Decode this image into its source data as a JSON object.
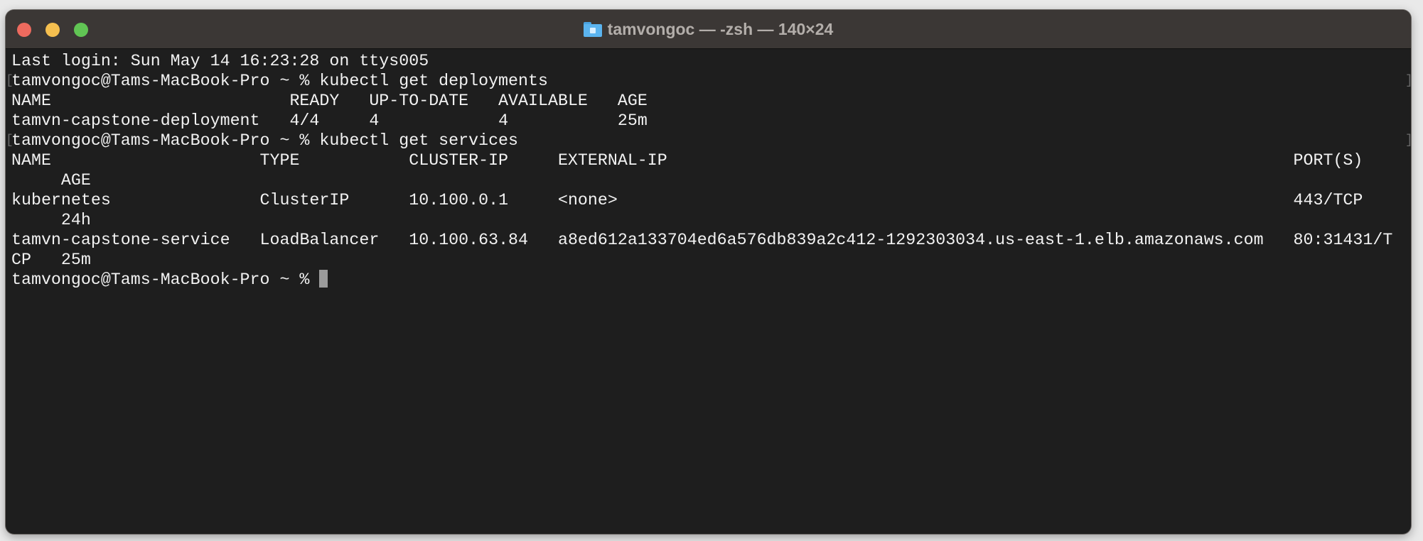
{
  "window": {
    "title": "tamvongoc — -zsh — 140×24",
    "title_icon": "home-folder-icon",
    "traffic_lights": {
      "close": "#ed6a5e",
      "minimize": "#f5bf4f",
      "zoom": "#61c554"
    }
  },
  "terminal": {
    "background": "#1e1e1e",
    "foreground": "#f2f2f2",
    "last_login": "Last login: Sun May 14 16:23:28 on ttys005",
    "prompt": "tamvongoc@Tams-MacBook-Pro ~ % ",
    "commands": [
      {
        "command": "kubectl get deployments",
        "output": {
          "headers": [
            "NAME",
            "READY",
            "UP-TO-DATE",
            "AVAILABLE",
            "AGE"
          ],
          "rows": [
            [
              "tamvn-capstone-deployment",
              "4/4",
              "4",
              "4",
              "25m"
            ]
          ]
        }
      },
      {
        "command": "kubectl get services",
        "output": {
          "headers": [
            "NAME",
            "TYPE",
            "CLUSTER-IP",
            "EXTERNAL-IP",
            "PORT(S)",
            "AGE"
          ],
          "rows": [
            [
              "kubernetes",
              "ClusterIP",
              "10.100.0.1",
              "<none>",
              "443/TCP",
              "24h"
            ],
            [
              "tamvn-capstone-service",
              "LoadBalancer",
              "10.100.63.84",
              "a8ed612a133704ed6a576db839a2c412-1292303034.us-east-1.elb.amazonaws.com",
              "80:31431/TCP",
              "25m"
            ]
          ]
        }
      }
    ],
    "current_input": ""
  }
}
